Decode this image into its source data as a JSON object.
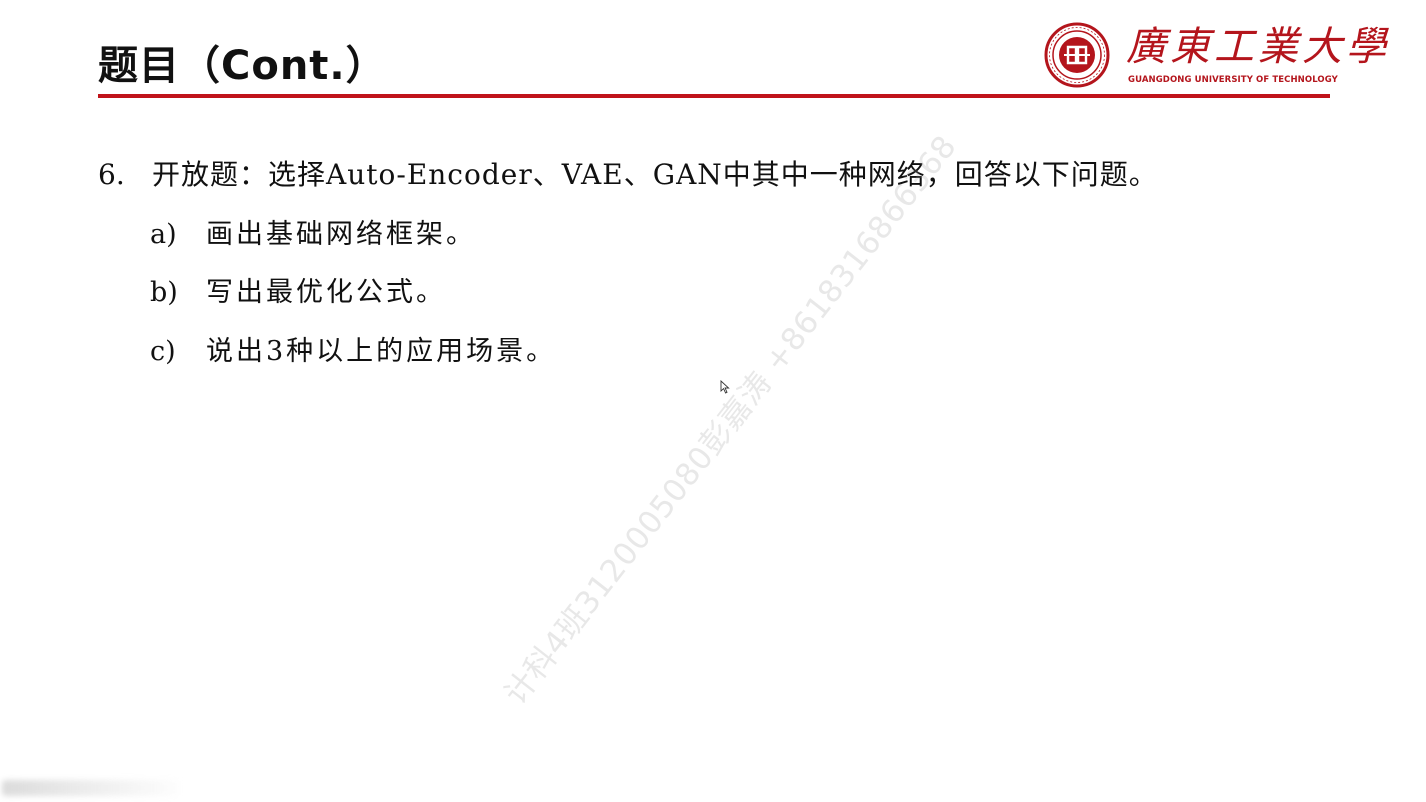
{
  "slide": {
    "title": "题目（Cont.）",
    "accent_color": "#c0131a"
  },
  "logo": {
    "seal_icon": "university-seal-icon",
    "name_cn": "廣東工業大學",
    "name_en": "GUANGDONG UNIVERSITY OF TECHNOLOGY",
    "color": "#b4151c"
  },
  "question": {
    "number": "6.",
    "text": "开放题：选择Auto-Encoder、VAE、GAN中其中一种网络，回答以下问题。",
    "subitems": [
      {
        "label": "a)",
        "text": "画出基础网络框架。"
      },
      {
        "label": "b)",
        "text": "写出最优化公式。"
      },
      {
        "label": "c)",
        "text": "说出3种以上的应用场景。"
      }
    ]
  },
  "watermark": {
    "text": "计科4班3120005080彭嘉涛 +8618316866368"
  },
  "cursor_icon": "mouse-pointer-icon"
}
